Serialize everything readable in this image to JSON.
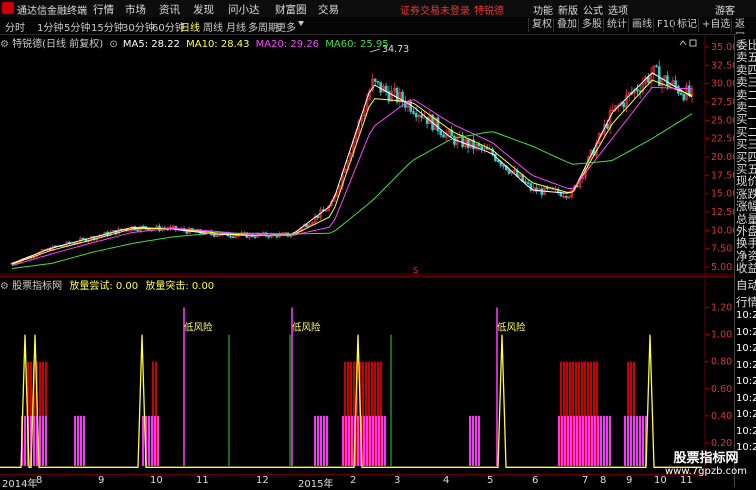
{
  "titlebar": {
    "app_name": "通达信金融终端",
    "menus": [
      "行情",
      "市场",
      "资讯",
      "发现",
      "问小达",
      "财富圈",
      "交易"
    ],
    "notice": "证券交易未登录",
    "stock": "特锐德",
    "right_items": [
      "功能",
      "新版",
      "公式",
      "选项",
      "游客"
    ]
  },
  "periodbar": {
    "periods": [
      "分时",
      "1分钟",
      "5分钟",
      "15分钟",
      "30分钟",
      "60分钟",
      "日线",
      "周线",
      "月线",
      "多周期",
      "更多"
    ],
    "active": "日线",
    "tools": [
      "复权",
      "叠加",
      "多股",
      "统计",
      "画线",
      "F10",
      "标记",
      "+自选",
      "返回"
    ]
  },
  "main_header": {
    "name": "特锐德(日线 前复权)",
    "ma5": "MA5: 28.22",
    "ma10": "MA10: 28.43",
    "ma20": "MA20: 29.26",
    "ma60": "MA60: 25.95"
  },
  "sub_header": {
    "name": "股票指标网",
    "f1": "放量尝试: 0.00",
    "f2": "放量突击: 0.00"
  },
  "annotations": {
    "high": "34.73",
    "signal": "低风险",
    "marker": "S"
  },
  "right_panel": {
    "top_items": [
      "委比",
      "卖五",
      "卖四",
      "卖三",
      "卖二",
      "卖一",
      "买一",
      "买二",
      "买三",
      "买四",
      "买五",
      "现价",
      "涨跌",
      "涨幅",
      "总量",
      "外盘",
      "换手",
      "净资",
      "收益"
    ],
    "bottom_items": [
      "自动",
      "行情",
      "10:26",
      "10:26",
      "10:26",
      "10:26",
      "10:26",
      "10:26",
      "10:26",
      "10:26",
      "10:26"
    ]
  },
  "x_axis_labels": [
    "2014年",
    "8",
    "9",
    "10",
    "11",
    "12",
    "2015年",
    "2",
    "3",
    "4",
    "5",
    "6",
    "7",
    "8",
    "9",
    "10",
    "11"
  ],
  "main_y_labels": [
    "35.00",
    "32.50",
    "30.00",
    "27.50",
    "25.00",
    "22.50",
    "20.00",
    "17.50",
    "15.00",
    "12.50",
    "10.00",
    "7.50",
    "5.00"
  ],
  "sub_y_labels": [
    "1.20",
    "1.00",
    "0.80",
    "0.60",
    "0.40",
    "0.20"
  ],
  "watermark": {
    "line1": "股票指标网",
    "line2": "www.7gpzb.com"
  },
  "colors": {
    "up": "#ff3333",
    "down": "#33cccc",
    "ma5": "#ffffff",
    "ma10": "#ffff44",
    "ma20": "#ff44ff",
    "ma60": "#44dd44",
    "sub_yellow": "#ffff33",
    "sub_red": "#ff0000",
    "sub_magenta": "#ff33ff",
    "sub_green": "#33cc33"
  },
  "chart_data": [
    {
      "type": "line",
      "title": "特锐德(日线 前复权)",
      "x": [
        "2014-07",
        "2014-08",
        "2014-09",
        "2014-10",
        "2014-11",
        "2014-12",
        "2015-01",
        "2015-02",
        "2015-03",
        "2015-04",
        "2015-05",
        "2015-06",
        "2015-07",
        "2015-08",
        "2015-09",
        "2015-10",
        "2015-11",
        "2015-12"
      ],
      "series": [
        {
          "name": "MA5",
          "values": [
            5.5,
            7.6,
            9.0,
            10.4,
            10.2,
            9.5,
            9.3,
            9.4,
            13.5,
            30.0,
            27.0,
            22.5,
            20.5,
            15.5,
            15.0,
            26.0,
            31.5,
            28.2
          ]
        },
        {
          "name": "MA10",
          "values": [
            5.4,
            7.3,
            8.7,
            10.2,
            10.3,
            9.7,
            9.3,
            9.3,
            12.0,
            28.0,
            27.5,
            23.5,
            21.0,
            16.5,
            15.0,
            24.5,
            30.5,
            28.4
          ]
        },
        {
          "name": "MA20",
          "values": [
            5.2,
            6.8,
            8.3,
            9.7,
            10.3,
            9.9,
            9.4,
            9.3,
            10.5,
            24.0,
            28.0,
            24.5,
            22.0,
            17.5,
            15.5,
            22.5,
            29.5,
            29.3
          ]
        },
        {
          "name": "MA60",
          "values": [
            4.8,
            5.5,
            7.0,
            8.2,
            9.1,
            9.6,
            9.6,
            9.5,
            9.6,
            14.0,
            19.5,
            22.5,
            23.5,
            21.5,
            19.0,
            19.5,
            22.5,
            25.9
          ]
        }
      ],
      "ylim": [
        5.0,
        35.0
      ]
    },
    {
      "type": "bar",
      "title": "股票指标网",
      "series": [
        {
          "name": "放量尝试",
          "values": [
            0.0
          ]
        },
        {
          "name": "放量突击",
          "values": [
            0.0
          ]
        }
      ],
      "ylim": [
        0.0,
        1.3
      ]
    }
  ]
}
